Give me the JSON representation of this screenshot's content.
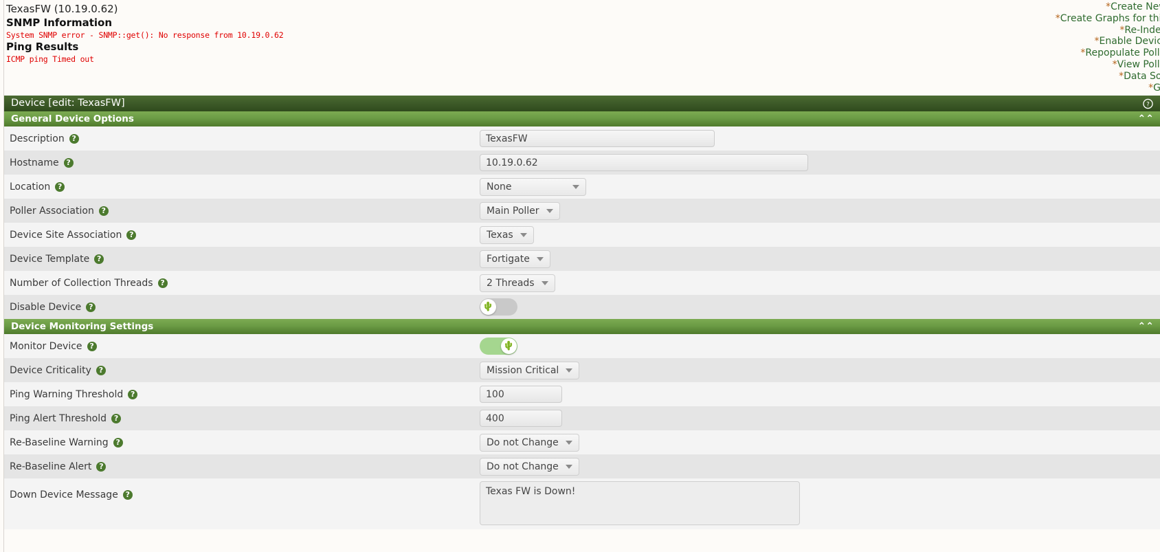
{
  "header": {
    "device_title": "TexasFW (10.19.0.62)",
    "snmp_heading": "SNMP Information",
    "snmp_error": "System SNMP error - SNMP::get(): No response from 10.19.0.62",
    "ping_heading": "Ping Results",
    "ping_result": "ICMP ping Timed out"
  },
  "actions": {
    "items": [
      "Create New Device",
      "Create Graphs for this Device",
      "Re-Index Device",
      "Enable Device Debug",
      "Repopulate Poller Cache",
      "View Poller Cache",
      "Data Source List",
      "Graph List"
    ],
    "prefix": "*"
  },
  "panel": {
    "title": "Device [edit: TexasFW]",
    "help_icon": "question-mark-circle",
    "sections": [
      {
        "title": "General Device Options",
        "collapse_icon": "«"
      },
      {
        "title": "Device Monitoring Settings",
        "collapse_icon": "«"
      }
    ]
  },
  "fields": {
    "description": {
      "label": "Description",
      "value": "TexasFW"
    },
    "hostname": {
      "label": "Hostname",
      "value": "10.19.0.62"
    },
    "location": {
      "label": "Location",
      "value": "None"
    },
    "poller_association": {
      "label": "Poller Association",
      "value": "Main Poller"
    },
    "device_site_association": {
      "label": "Device Site Association",
      "value": "Texas"
    },
    "device_template": {
      "label": "Device Template",
      "value": "Fortigate"
    },
    "collection_threads": {
      "label": "Number of Collection Threads",
      "value": "2 Threads"
    },
    "disable_device": {
      "label": "Disable Device",
      "state": "off"
    },
    "monitor_device": {
      "label": "Monitor Device",
      "state": "on"
    },
    "device_criticality": {
      "label": "Device Criticality",
      "value": "Mission Critical"
    },
    "ping_warning_threshold": {
      "label": "Ping Warning Threshold",
      "value": "100"
    },
    "ping_alert_threshold": {
      "label": "Ping Alert Threshold",
      "value": "400"
    },
    "rebaseline_warning": {
      "label": "Re-Baseline Warning",
      "value": "Do not Change"
    },
    "rebaseline_alert": {
      "label": "Re-Baseline Alert",
      "value": "Do not Change"
    },
    "down_device_message": {
      "label": "Down Device Message",
      "value": "Texas FW is Down!"
    }
  },
  "icons": {
    "help": "?",
    "cactus": "♣"
  }
}
